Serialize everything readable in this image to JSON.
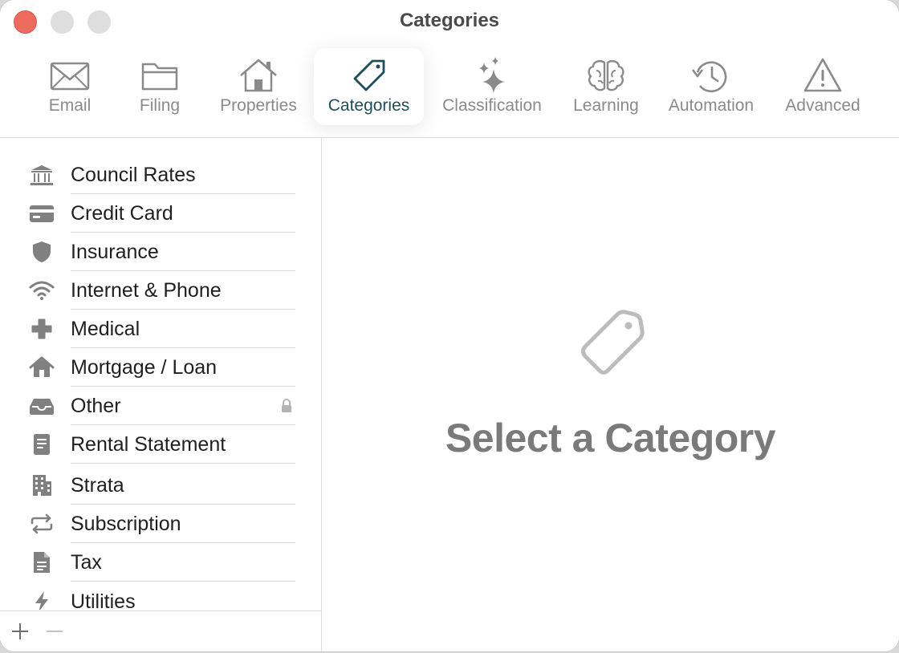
{
  "window": {
    "title": "Categories"
  },
  "toolbar": {
    "tabs": [
      {
        "label": "Email",
        "icon": "envelope-icon"
      },
      {
        "label": "Filing",
        "icon": "folder-icon"
      },
      {
        "label": "Properties",
        "icon": "house-icon"
      },
      {
        "label": "Categories",
        "icon": "tag-icon",
        "active": true
      },
      {
        "label": "Classification",
        "icon": "sparkles-icon"
      },
      {
        "label": "Learning",
        "icon": "brain-icon"
      },
      {
        "label": "Automation",
        "icon": "clock-arrow-icon"
      },
      {
        "label": "Advanced",
        "icon": "warning-triangle-icon"
      }
    ]
  },
  "sidebar": {
    "items": [
      {
        "label": "Council Rates",
        "icon": "bank-icon"
      },
      {
        "label": "Credit Card",
        "icon": "credit-card-icon"
      },
      {
        "label": "Insurance",
        "icon": "shield-icon"
      },
      {
        "label": "Internet & Phone",
        "icon": "wifi-icon"
      },
      {
        "label": "Medical",
        "icon": "cross-icon"
      },
      {
        "label": "Mortgage / Loan",
        "icon": "house-icon"
      },
      {
        "label": "Other",
        "icon": "tray-icon",
        "locked": true
      },
      {
        "label": "Rental Statement",
        "icon": "document-icon"
      },
      {
        "label": "Strata",
        "icon": "building-icon"
      },
      {
        "label": "Subscription",
        "icon": "repeat-icon"
      },
      {
        "label": "Tax",
        "icon": "doc-text-icon"
      },
      {
        "label": "Utilities",
        "icon": "bolt-icon"
      }
    ],
    "add_button": "+",
    "remove_button": "−"
  },
  "main": {
    "empty_title": "Select a Category",
    "empty_icon": "tag-icon"
  },
  "colors": {
    "accent": "#1e4e5c",
    "icon_gray": "#8a8a8a",
    "close_button": "#ed6a5e",
    "empty_title": "#7a7a7a"
  }
}
